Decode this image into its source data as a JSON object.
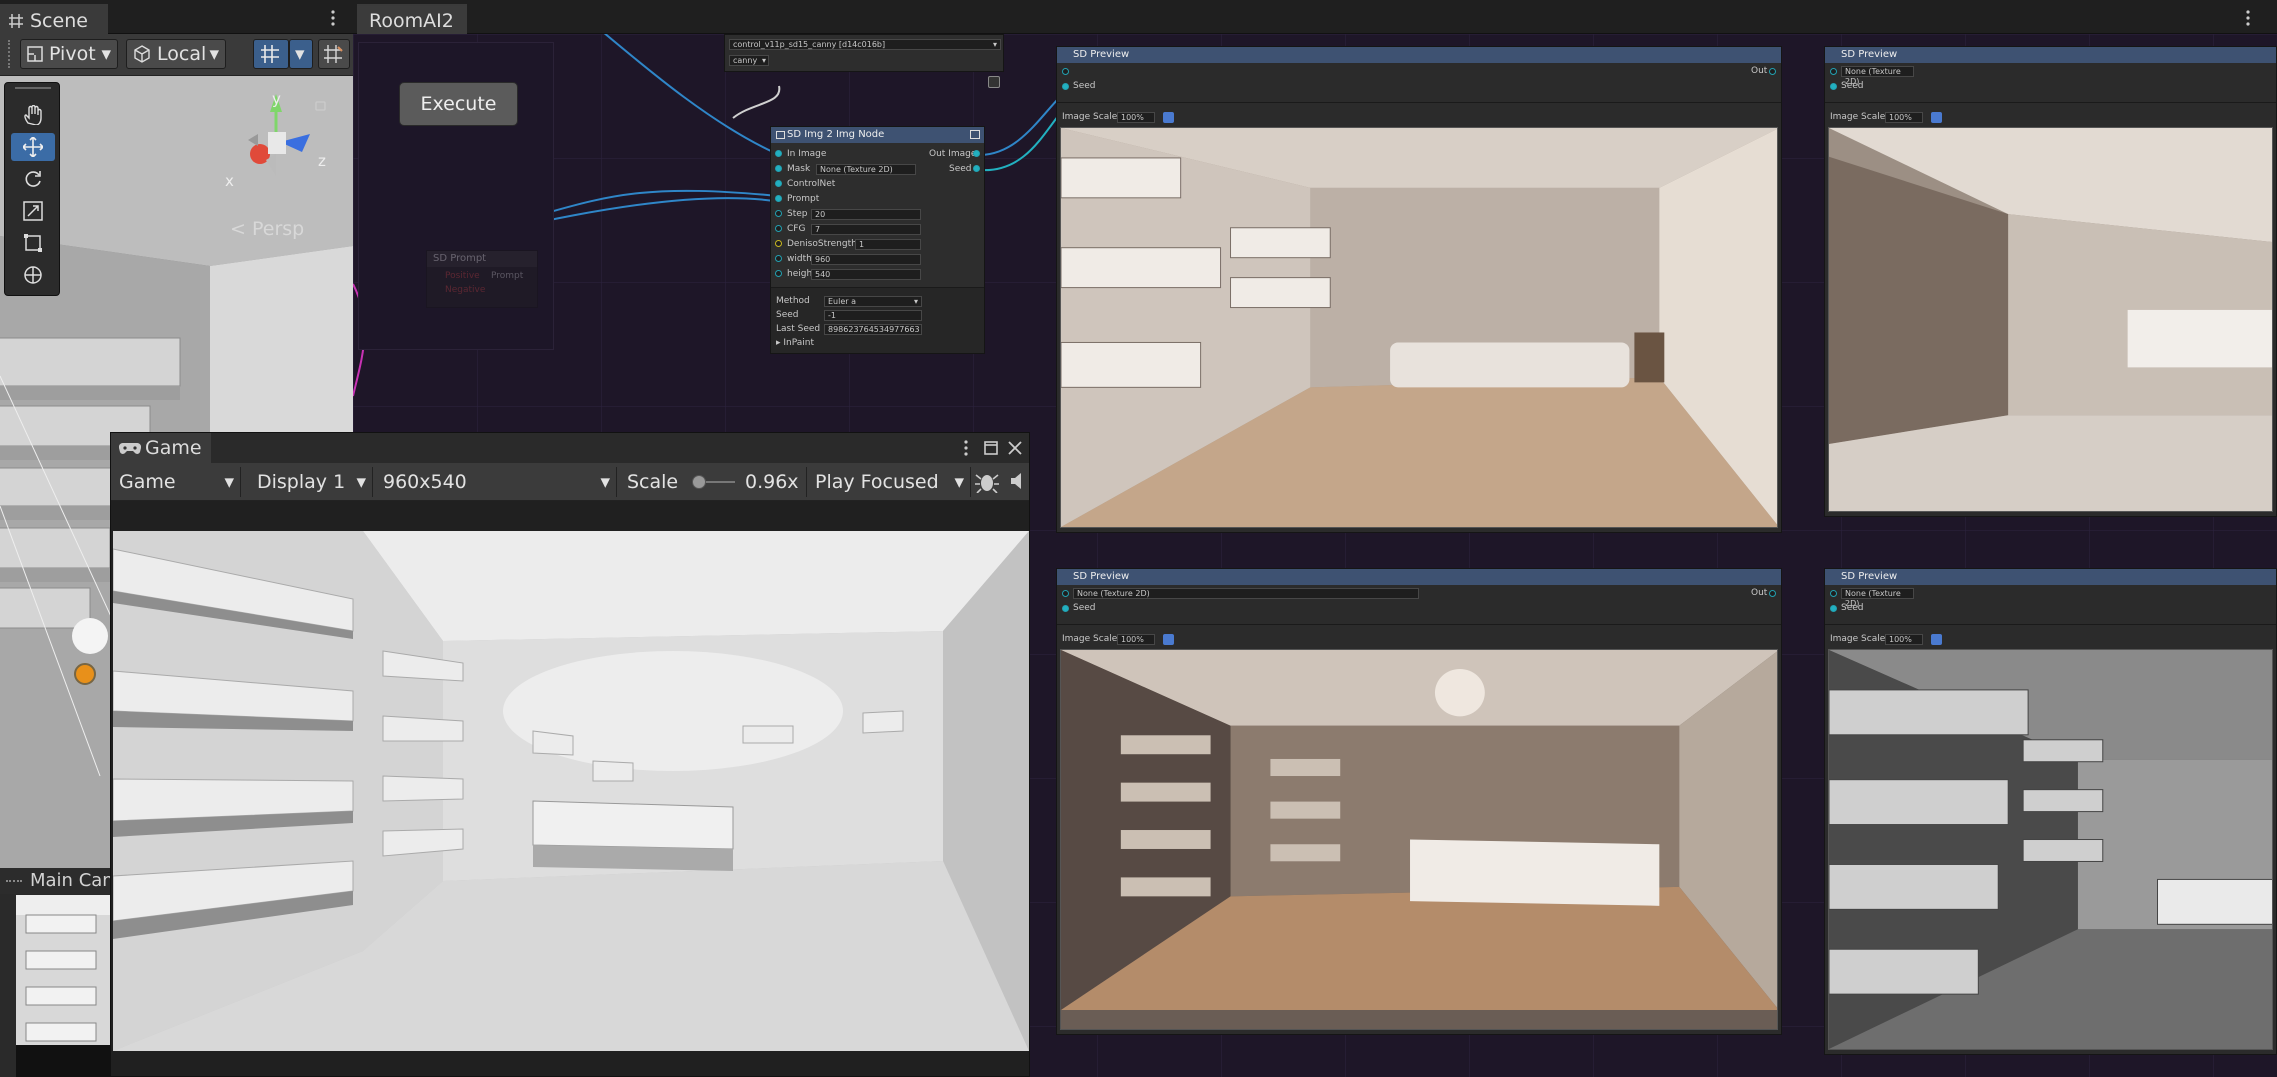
{
  "scene": {
    "tab_label": "Scene",
    "pivot_label": "Pivot",
    "local_label": "Local",
    "persp_label": "Persp",
    "gizmo_axes": {
      "y": "y",
      "z": "z",
      "x": "x"
    },
    "main_camera_label": "Main Cam"
  },
  "graph": {
    "tab_label": "RoomAI2",
    "execute_label": "Execute",
    "controlnet_model": "control_v11p_sd15_canny [d14c016b]",
    "controlnet_preprocessor": "canny",
    "prompt_node": {
      "title": "SD Prompt",
      "positive": "Positive",
      "negative": "Negative",
      "prompt_out": "Prompt"
    },
    "img2img": {
      "title": "SD Img 2 Img Node",
      "inputs": [
        "In Image",
        "Mask",
        "ControlNet",
        "Prompt"
      ],
      "mask_value": "None (Texture 2D)",
      "outputs": [
        "Out Image",
        "Seed"
      ],
      "params": [
        {
          "label": "Step",
          "value": "20"
        },
        {
          "label": "CFG",
          "value": "7"
        },
        {
          "label": "DenisoStrength",
          "value": "1"
        },
        {
          "label": "width",
          "value": "960"
        },
        {
          "label": "height",
          "value": "540"
        }
      ],
      "method_label": "Method",
      "method_value": "Euler a",
      "seed_label": "Seed",
      "seed_value": "-1",
      "last_seed_label": "Last Seed",
      "last_seed_value": "898623764534977663",
      "inpaint_label": "InPaint"
    },
    "previews": [
      {
        "title": "SD Preview",
        "input": "",
        "seed": "Seed",
        "out": "Out",
        "scale_label": "Image Scale",
        "scale_value": "100%"
      },
      {
        "title": "SD Preview",
        "input": "None (Texture 2D)",
        "seed": "Seed",
        "out": "",
        "scale_label": "Image Scale",
        "scale_value": "100%"
      },
      {
        "title": "SD Preview",
        "input": "None (Texture 2D)",
        "seed": "Seed",
        "out": "Out",
        "scale_label": "Image Scale",
        "scale_value": "100%"
      },
      {
        "title": "SD Preview",
        "input": "None (Texture 2D)",
        "seed": "Seed",
        "out": "",
        "scale_label": "Image Scale",
        "scale_value": "100%"
      }
    ]
  },
  "game": {
    "tab_label": "Game",
    "view_dropdown": "Game",
    "display_dropdown": "Display 1",
    "resolution_dropdown": "960x540",
    "scale_label": "Scale",
    "scale_value": "0.96x",
    "scale_fraction": 0.1,
    "play_mode_dropdown": "Play Focused"
  },
  "colors": {
    "graph_bg": "#1e1628",
    "edge_blue": "#2f86c8",
    "edge_magenta": "#c832b4",
    "node_header": "#3e5272",
    "port_cyan": "#22b0c0"
  }
}
